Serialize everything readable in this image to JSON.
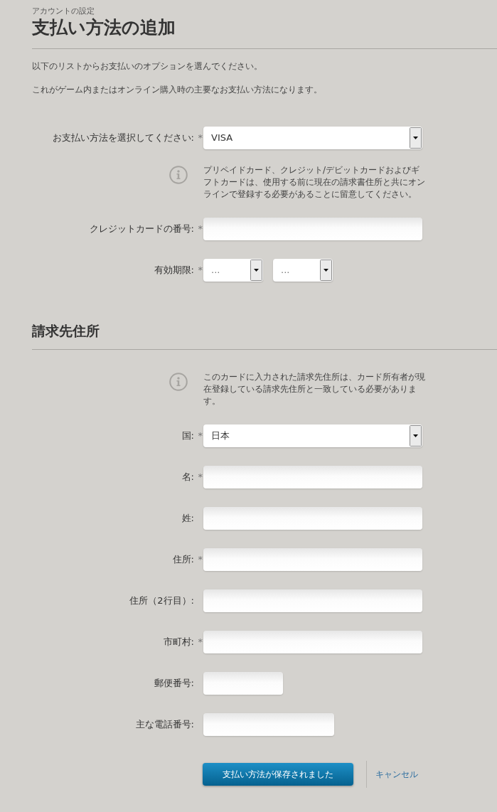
{
  "breadcrumb": "アカウントの設定",
  "title": "支払い方法の追加",
  "intro": [
    "以下のリストからお支払いのオプションを選んでください。",
    "これがゲーム内またはオンライン購入時の主要なお支払い方法になります。"
  ],
  "payment_fields": [
    {
      "kind": "select",
      "label": "お支払い方法を選択してください:",
      "marker": "*",
      "value": "VISA"
    },
    {
      "kind": "note",
      "text": "プリペイドカード、クレジット/デビットカードおよびギフトカードは、使用する前に現在の請求書住所と共にオンラインで登録する必要があることに留意してください。"
    },
    {
      "kind": "text",
      "label": "クレジットカードの番号:",
      "marker": "*"
    },
    {
      "kind": "selectpair",
      "label": "有効期限:",
      "marker": "*",
      "values": [
        "...",
        "..."
      ]
    }
  ],
  "billing_section": {
    "heading": "請求先住所",
    "fields": [
      {
        "kind": "note",
        "text": "このカードに入力された請求先住所は、カード所有者が現在登録している請求先住所と一致している必要があります。"
      },
      {
        "kind": "select",
        "label": "国:",
        "marker": "*",
        "value": "日本"
      },
      {
        "kind": "text",
        "label": "名:",
        "marker": "*"
      },
      {
        "kind": "text",
        "label": "姓:"
      },
      {
        "kind": "text",
        "label": "住所:",
        "marker": "*"
      },
      {
        "kind": "text",
        "label": "住所（2行目）:"
      },
      {
        "kind": "text",
        "label": "市町村:",
        "marker": "*"
      },
      {
        "kind": "postcode",
        "label": "郵便番号:"
      },
      {
        "kind": "phone",
        "label": "主な電話番号:"
      }
    ]
  },
  "actions": {
    "submit": "支払い方法が保存されました",
    "cancel": "キャンセル"
  }
}
